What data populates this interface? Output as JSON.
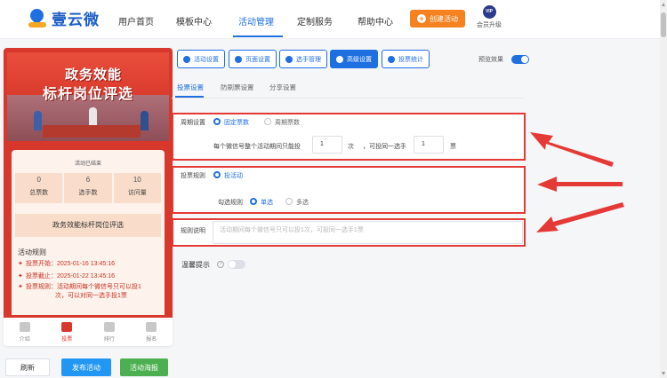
{
  "brand": {
    "name": "壹云微",
    "logo_icon": "water-drop-logo"
  },
  "nav": {
    "items": [
      "用户首页",
      "模板中心",
      "活动管理",
      "定制服务",
      "帮助中心"
    ],
    "active": "活动管理",
    "create_label": "创建活动",
    "vip_badge": "VIP",
    "vip_label": "会员升级"
  },
  "colors": {
    "accent": "#1e6fe0",
    "orange": "#f5821f",
    "red": "#d8372b",
    "annotation": "#e53935",
    "green": "#4caf50"
  },
  "preview": {
    "banner_line1": "政务效能",
    "banner_line2": "标杆岗位评选",
    "stats_head": "活动已结束",
    "stats": [
      {
        "value": "0",
        "label": "总票数"
      },
      {
        "value": "6",
        "label": "选手数"
      },
      {
        "value": "10",
        "label": "访问量"
      }
    ],
    "activity_title": "政务效能标杆岗位评选",
    "rules_title": "活动规则",
    "rules": [
      "投票开始：2025-01-16 13:45:16",
      "投票截止：2025-01-22 13:45:16",
      "投票规则：活动期间每个微信号只可以投1",
      "次，可以对同一选手投1票"
    ],
    "tabs": [
      {
        "label": "介绍",
        "icon": "intro-icon"
      },
      {
        "label": "投票",
        "icon": "vote-icon"
      },
      {
        "label": "排行",
        "icon": "crown-icon"
      },
      {
        "label": "报名",
        "icon": "signup-icon"
      }
    ],
    "active_tab": "投票"
  },
  "bottom": {
    "refresh": "刷新",
    "publish": "发布活动",
    "poster": "活动海报"
  },
  "toolbar": {
    "buttons": [
      "活动设置",
      "页面设置",
      "选手管理",
      "高级设置",
      "投票统计"
    ],
    "active": "高级设置",
    "preview_label": "预览效果",
    "preview_on": true
  },
  "subtabs": {
    "items": [
      "投票设置",
      "防刷票设置",
      "分享设置"
    ],
    "active": "投票设置"
  },
  "period": {
    "label": "周期设置",
    "options": [
      "固定票数",
      "周期票数"
    ],
    "selected": "固定票数",
    "text_a": "每个微信号整个活动期间只能投",
    "value_a": "1",
    "unit_a": "次",
    "text_b": "，可投同一选手",
    "value_b": "1",
    "unit_b": "票"
  },
  "vote_rule": {
    "label": "投票规则",
    "option": "投活动",
    "check_label": "勾选规则",
    "check_options": [
      "单选",
      "多选"
    ],
    "check_selected": "单选"
  },
  "rule_desc": {
    "label": "规则说明",
    "placeholder": "活动期间每个微信号只可以投1次，可投同一选手1票"
  },
  "tips": {
    "label": "温馨提示",
    "enabled": false
  }
}
